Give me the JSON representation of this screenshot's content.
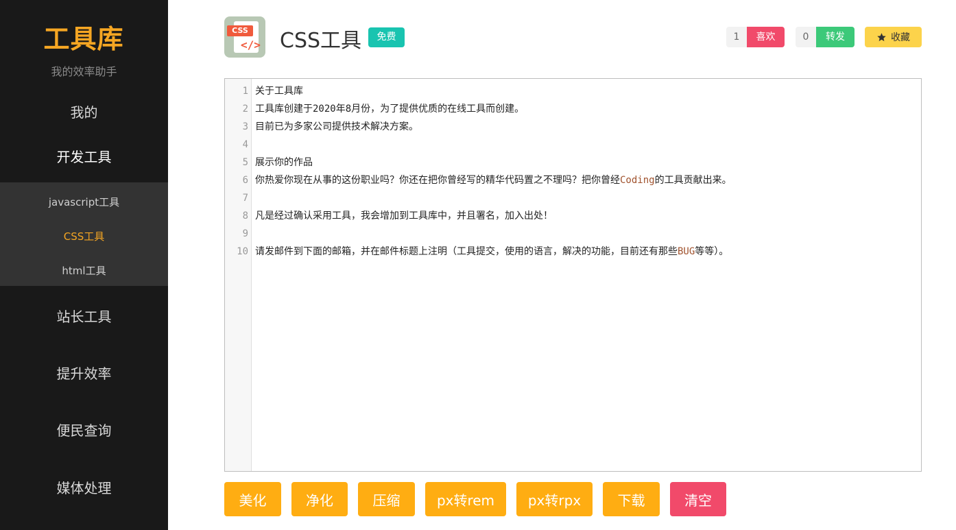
{
  "sidebar": {
    "logo_text": "工具库",
    "slogan": "我的效率助手",
    "nav": {
      "mine": "我的",
      "dev_tools": "开发工具",
      "webmaster_tools": "站长工具",
      "productivity": "提升效率",
      "convenience": "便民查询",
      "media": "媒体处理"
    },
    "subnav": {
      "javascript": "javascript工具",
      "css": "CSS工具",
      "html": "html工具"
    }
  },
  "header": {
    "icon_tag": "CSS",
    "icon_symbol": "</>",
    "title": "CSS工具",
    "badge": "免费",
    "like_count": "1",
    "like_label": "喜欢",
    "share_count": "0",
    "share_label": "转发",
    "fav_label": "收藏"
  },
  "colors": {
    "accent": "#ffad12",
    "like": "#f14a6a",
    "share": "#3cc979",
    "badge": "#19c4b0",
    "favorite": "#fcd34b",
    "sidebar_bg": "#191919"
  },
  "editor": {
    "lines": [
      {
        "n": "1",
        "pre": "关于工具库",
        "kw": "",
        "post": ""
      },
      {
        "n": "2",
        "pre": "工具库创建于2020年8月份，为了提供优质的在线工具而创建。",
        "kw": "",
        "post": ""
      },
      {
        "n": "3",
        "pre": "目前已为多家公司提供技术解决方案。",
        "kw": "",
        "post": ""
      },
      {
        "n": "4",
        "pre": "",
        "kw": "",
        "post": ""
      },
      {
        "n": "5",
        "pre": "展示你的作品",
        "kw": "",
        "post": ""
      },
      {
        "n": "6",
        "pre": "你热爱你现在从事的这份职业吗？你还在把你曾经写的精华代码置之不理吗？把你曾经",
        "kw": "Coding",
        "post": "的工具贡献出来。"
      },
      {
        "n": "7",
        "pre": "",
        "kw": "",
        "post": ""
      },
      {
        "n": "8",
        "pre": "凡是经过确认采用工具，我会增加到工具库中，并且署名，加入出处！",
        "kw": "",
        "post": ""
      },
      {
        "n": "9",
        "pre": "",
        "kw": "",
        "post": ""
      },
      {
        "n": "10",
        "pre": "请发邮件到下面的邮箱，并在邮件标题上注明（工具提交，使用的语言，解决的功能，目前还有那些",
        "kw": "BUG",
        "post": "等等）。"
      }
    ]
  },
  "actions": {
    "beautify": "美化",
    "purify": "净化",
    "compress": "压缩",
    "px_rem": "px转rem",
    "px_rpx": "px转rpx",
    "download": "下载",
    "clear": "清空"
  }
}
